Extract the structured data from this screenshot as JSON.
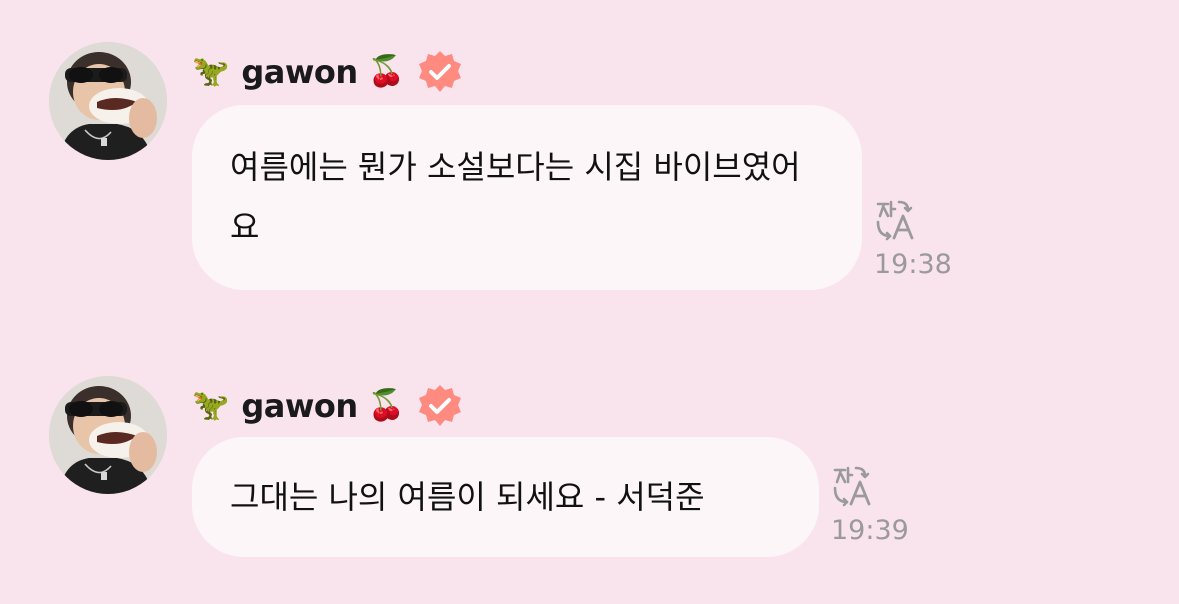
{
  "colors": {
    "background": "#f9e4ee",
    "bubble": "#fdf6f9",
    "verified_badge": "#ff8a80",
    "timestamp": "#9a9a9a"
  },
  "messages": [
    {
      "user": {
        "prefix_emoji": "🦖",
        "name": "gawon",
        "suffix_emoji": "🍒",
        "verified": true
      },
      "text": "여름에는 뭔가 소설보다는 시집 바이브였어요",
      "time": "19:38",
      "translate_icon": "translate-icon"
    },
    {
      "user": {
        "prefix_emoji": "🦖",
        "name": "gawon",
        "suffix_emoji": "🍒",
        "verified": true
      },
      "text": "그대는 나의 여름이 되세요 - 서덕준",
      "time": "19:39",
      "translate_icon": "translate-icon"
    }
  ]
}
